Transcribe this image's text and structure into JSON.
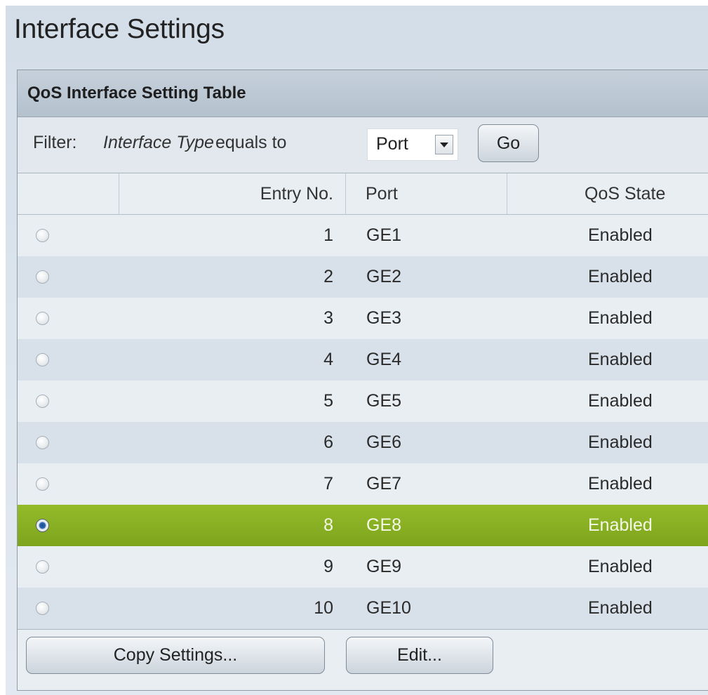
{
  "page": {
    "title": "Interface Settings"
  },
  "panel": {
    "title": "QoS Interface Setting Table"
  },
  "filter": {
    "label": "Filter:",
    "field": "Interface Type",
    "operator": "equals to",
    "selected_value": "Port",
    "go_label": "Go"
  },
  "table": {
    "columns": [
      "",
      "Entry No.",
      "Port",
      "QoS State"
    ],
    "rows": [
      {
        "entry": "1",
        "port": "GE1",
        "state": "Enabled",
        "selected": false
      },
      {
        "entry": "2",
        "port": "GE2",
        "state": "Enabled",
        "selected": false
      },
      {
        "entry": "3",
        "port": "GE3",
        "state": "Enabled",
        "selected": false
      },
      {
        "entry": "4",
        "port": "GE4",
        "state": "Enabled",
        "selected": false
      },
      {
        "entry": "5",
        "port": "GE5",
        "state": "Enabled",
        "selected": false
      },
      {
        "entry": "6",
        "port": "GE6",
        "state": "Enabled",
        "selected": false
      },
      {
        "entry": "7",
        "port": "GE7",
        "state": "Enabled",
        "selected": false
      },
      {
        "entry": "8",
        "port": "GE8",
        "state": "Enabled",
        "selected": true
      },
      {
        "entry": "9",
        "port": "GE9",
        "state": "Enabled",
        "selected": false
      },
      {
        "entry": "10",
        "port": "GE10",
        "state": "Enabled",
        "selected": false
      }
    ]
  },
  "actions": {
    "copy_label": "Copy Settings...",
    "edit_label": "Edit..."
  },
  "colors": {
    "selected_row": "#88ae22",
    "header_bar": "#bcc8d4",
    "row_alt": "#d8e1ea"
  },
  "icons": {
    "dropdown": "chevron-down-icon",
    "radio": "radio-button"
  }
}
